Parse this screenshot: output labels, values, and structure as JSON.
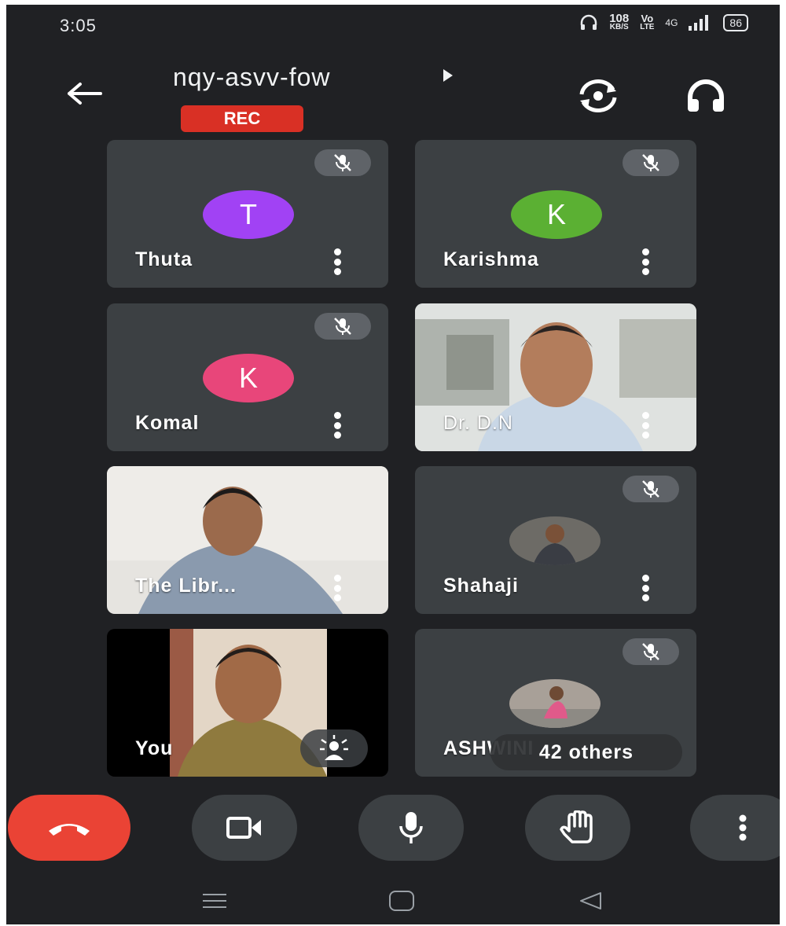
{
  "status_bar": {
    "time": "3:05",
    "net_speed_value": "108",
    "net_speed_unit": "KB/S",
    "volte_top": "Vo",
    "volte_bottom": "LTE",
    "network": "4G",
    "battery": "86"
  },
  "header": {
    "meeting_code": "nqy-asvv-fow",
    "recording_badge": "REC"
  },
  "participants": [
    {
      "name": "Thuta",
      "initial": "T",
      "avatar_color": "#a142f4",
      "type": "avatar",
      "muted": true
    },
    {
      "name": "Karishma",
      "initial": "K",
      "avatar_color": "#5bb033",
      "type": "avatar",
      "muted": true
    },
    {
      "name": "Komal",
      "initial": "K",
      "avatar_color": "#e8467a",
      "type": "avatar",
      "muted": true
    },
    {
      "name": "Dr. D.N",
      "type": "video",
      "muted": false
    },
    {
      "name": "The Libr...",
      "type": "video",
      "muted": false
    },
    {
      "name": "Shahaji",
      "type": "photo",
      "muted": true
    },
    {
      "name": "You",
      "type": "self-video",
      "muted": false
    },
    {
      "name": "ASHWINI",
      "type": "photo",
      "muted": true,
      "overlay": "42 others"
    }
  ],
  "colors": {
    "background": "#202124",
    "tile": "#3c4043",
    "end_call": "#ea4335",
    "rec": "#d93025",
    "mute_pill": "#5f6368"
  },
  "controls": [
    "end-call",
    "camera",
    "microphone",
    "raise-hand",
    "more-options"
  ],
  "nav": [
    "menu",
    "home",
    "back"
  ]
}
